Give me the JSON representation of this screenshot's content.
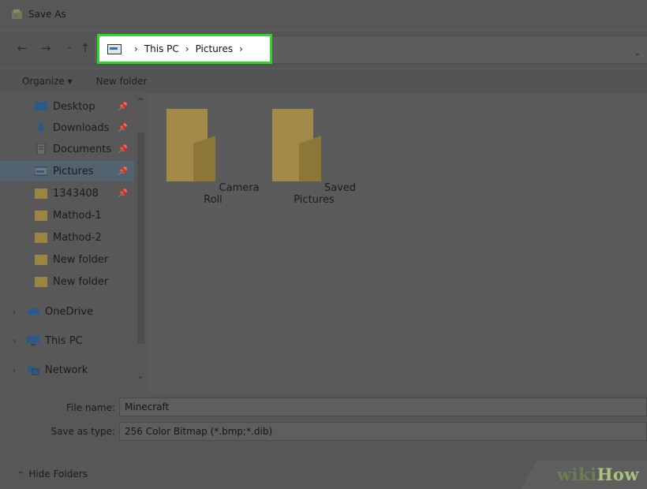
{
  "window": {
    "title": "Save As"
  },
  "nav_buttons": {
    "back": "←",
    "forward": "→",
    "recent": "⌄",
    "up": "↑"
  },
  "breadcrumb": {
    "items": [
      "This PC",
      "Pictures"
    ],
    "separator": "›"
  },
  "toolbar": {
    "organize_label": "Organize ▾",
    "new_folder_label": "New folder"
  },
  "sidebar": {
    "quick_access": [
      {
        "label": "Desktop",
        "icon": "desktop-icon",
        "pinned": true
      },
      {
        "label": "Downloads",
        "icon": "download-arrow-icon",
        "pinned": true
      },
      {
        "label": "Documents",
        "icon": "documents-icon",
        "pinned": true
      },
      {
        "label": "Pictures",
        "icon": "pictures-icon",
        "pinned": true,
        "selected": true
      },
      {
        "label": "1343408",
        "icon": "folder-icon",
        "pinned": true
      },
      {
        "label": "Mathod-1",
        "icon": "folder-icon",
        "pinned": false
      },
      {
        "label": "Mathod-2",
        "icon": "folder-icon",
        "pinned": false
      },
      {
        "label": "New folder",
        "icon": "folder-icon",
        "pinned": false
      },
      {
        "label": "New folder",
        "icon": "folder-icon",
        "pinned": false
      }
    ],
    "locations": [
      {
        "label": "OneDrive",
        "icon": "cloud-icon"
      },
      {
        "label": "This PC",
        "icon": "computer-icon"
      },
      {
        "label": "Network",
        "icon": "network-icon"
      }
    ]
  },
  "content": {
    "folders": [
      {
        "label": "Camera Roll",
        "icon": "folder-icon"
      },
      {
        "label": "Saved Pictures",
        "icon": "folder-icon"
      }
    ]
  },
  "form": {
    "file_name_label": "File name:",
    "file_name_value": "Minecraft",
    "save_type_label": "Save as type:",
    "save_type_value": "256 Color Bitmap (*.bmp;*.dib)"
  },
  "footer": {
    "hide_folders_label": "Hide Folders",
    "hide_folders_icon": "chevron-up-icon"
  },
  "watermark": {
    "wiki": "wiki",
    "how": "How"
  },
  "colors": {
    "highlight_border": "#2fd52f",
    "dim_overlay": "#5a5a5a",
    "folder": "#b59b4e"
  }
}
